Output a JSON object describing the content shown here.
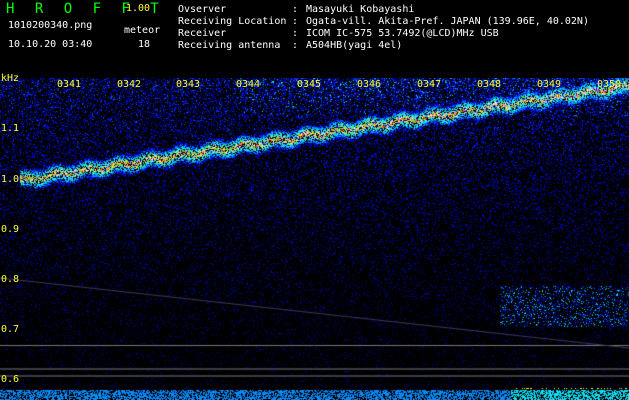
{
  "app": {
    "name": "H R O F F T",
    "version": "1.00"
  },
  "file": {
    "name": "1010200340.png",
    "datetime": "10.10.20 03:40"
  },
  "meteor": {
    "label": "meteor",
    "count": "18"
  },
  "info": [
    {
      "key": "Ovserver",
      "sep": ":",
      "value": "Masayuki Kobayashi"
    },
    {
      "key": "Receiving Location",
      "sep": ":",
      "value": "Ogata-vill. Akita-Pref. JAPAN (139.96E, 40.02N)"
    },
    {
      "key": "Receiver",
      "sep": ":",
      "value": "ICOM IC-575 53.7492(@LCD)MHz USB"
    },
    {
      "key": "Receiving antenna",
      "sep": ":",
      "value": "A504HB(yagi 4el)"
    }
  ],
  "axis": {
    "y_unit": "kHz",
    "y_labels": [
      "1.1",
      "1.0",
      "0.9",
      "0.8",
      "0.7",
      "0.6"
    ],
    "time_labels": [
      "0341",
      "0342",
      "0343",
      "0344",
      "0345",
      "0346",
      "0347",
      "0348",
      "0349",
      "0350"
    ]
  },
  "colors": {
    "header_app": "#00ff00",
    "version": "#ffff33",
    "axis_text": "#ffff33",
    "text": "#ffffff"
  }
}
